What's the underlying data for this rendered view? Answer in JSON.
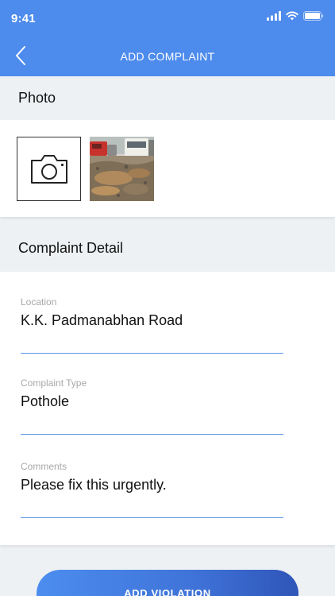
{
  "status_bar": {
    "time": "9:41",
    "icons": [
      "signal-icon",
      "wifi-icon",
      "battery-icon"
    ]
  },
  "header": {
    "back_icon": "chevron-left-icon",
    "title": "ADD COMPLAINT"
  },
  "photo_section": {
    "label": "Photo",
    "add_photo_icon": "camera-icon"
  },
  "complaint_section": {
    "label": "Complaint Detail",
    "fields": [
      {
        "label": "Location",
        "value": "K.K. Padmanabhan Road"
      },
      {
        "label": "Complaint Type",
        "value": "Pothole"
      },
      {
        "label": "Comments",
        "value": "Please fix this urgently."
      }
    ]
  },
  "cta": {
    "label": "ADD VIOLATION"
  },
  "colors": {
    "primary": "#4d8bec",
    "background": "#eef1f4",
    "field_underline": "#5b96e6",
    "label_gray": "#a8a8a8"
  }
}
